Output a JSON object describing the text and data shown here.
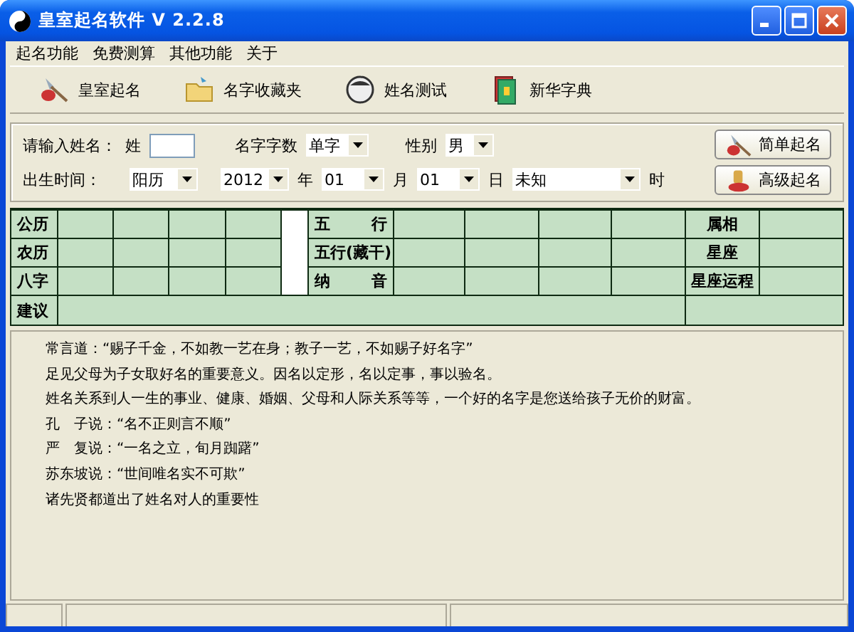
{
  "window": {
    "title": "皇室起名软件 V 2.2.8"
  },
  "menu": [
    "起名功能",
    "免费测算",
    "其他功能",
    "关于"
  ],
  "toolbar": [
    {
      "kind": "brush",
      "label": "皇室起名"
    },
    {
      "kind": "folder",
      "label": "名字收藏夹"
    },
    {
      "kind": "face",
      "label": "姓名测试"
    },
    {
      "kind": "book",
      "label": "新华字典"
    }
  ],
  "form": {
    "name_label": "请输入姓名：",
    "surname_label": "姓",
    "count_label": "名字字数",
    "count": "单字",
    "gender_label": "性别",
    "gender": "男",
    "birth_label": "出生时间：",
    "calendar": "阳历",
    "year": "2012",
    "year_unit": "年",
    "month": "01",
    "month_unit": "月",
    "day": "01",
    "day_unit": "日",
    "hour": "未知",
    "hour_unit": "时"
  },
  "buttons": [
    {
      "kind": "brush",
      "label": "简单起名"
    },
    {
      "kind": "seal",
      "label": "高级起名"
    }
  ],
  "grid": {
    "rows": [
      {
        "left": "公历",
        "middle": "五行",
        "right": "属相"
      },
      {
        "left": "农历",
        "middle": "五行(藏干)",
        "right": "星座"
      },
      {
        "left": "八字",
        "middle": "纳音",
        "right": "星座运程"
      }
    ],
    "advice_label": "建议"
  },
  "intro": [
    "常言道：“赐子千金，不如教一艺在身；教子一艺，不如赐子好名字”",
    "足见父母为子女取好名的重要意义。因名以定形，名以定事，事以验名。",
    "姓名关系到人一生的事业、健康、婚姻、父母和人际关系等等，一个好的名字是您送给孩子无价的财富。",
    "孔　子说：“名不正则言不顺”",
    "严　复说：“一名之立，旬月踟躇”",
    "苏东坡说：“世间唯名实不可欺”",
    "诸先贤都道出了姓名对人的重要性"
  ]
}
